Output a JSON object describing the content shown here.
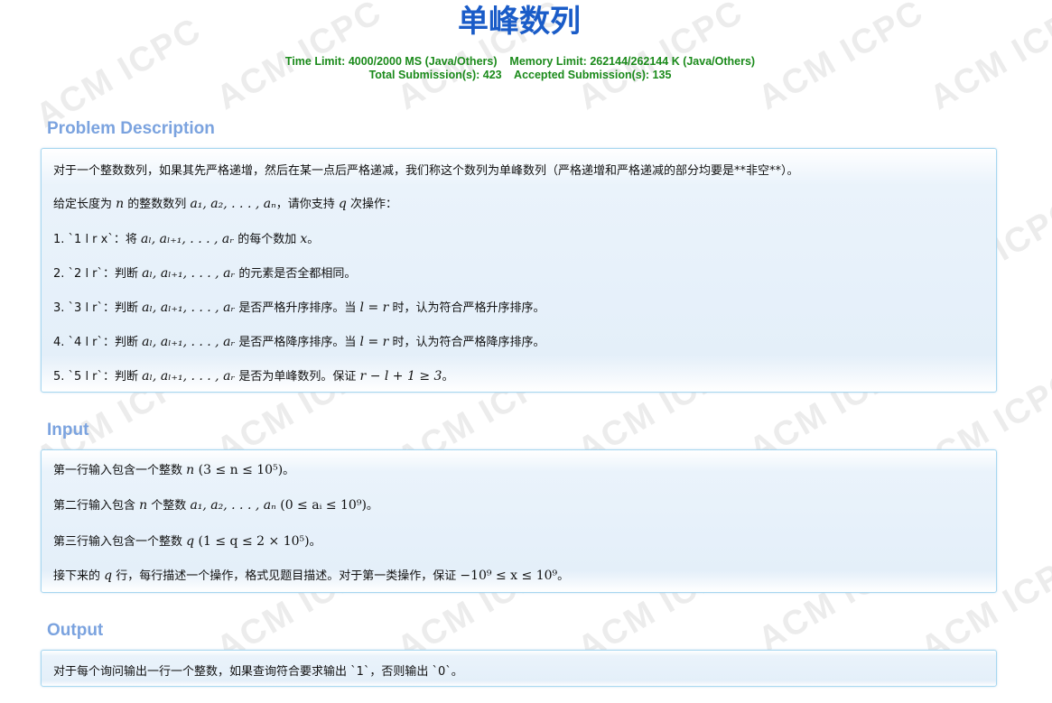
{
  "problem": {
    "title": "单峰数列",
    "time_limit": "Time Limit: 4000/2000 MS (Java/Others)",
    "memory_limit": "Memory Limit: 262144/262144 K (Java/Others)",
    "total_submissions": "Total Submission(s): 423",
    "accepted_submissions": "Accepted Submission(s): 135"
  },
  "watermark": "ACM ICPC",
  "sections": {
    "description": {
      "title": "Problem Description",
      "p1": "对于一个整数数列，如果其先严格递增，然后在某一点后严格递减，我们称这个数列为单峰数列（严格递增和严格递减的部分均要是**非空**）。",
      "p2_a": "给定长度为 ",
      "p2_n": "n",
      "p2_b": " 的整数数列 ",
      "p2_seq": "a₁, a₂, . . . , aₙ",
      "p2_c": "，请你支持 ",
      "p2_q": "q",
      "p2_d": " 次操作：",
      "op1_a": "1. `1 l r x`：将 ",
      "op1_seq": "aₗ, aₗ₊₁, . . . , aᵣ",
      "op1_b": " 的每个数加 ",
      "op1_x": "x",
      "op1_c": "。",
      "op2_a": "2. `2 l r`：判断 ",
      "op2_seq": "aₗ, aₗ₊₁, . . . , aᵣ",
      "op2_b": " 的元素是否全都相同。",
      "op3_a": "3. `3 l r`：判断 ",
      "op3_seq": "aₗ, aₗ₊₁, . . . , aᵣ",
      "op3_b": " 是否严格升序排序。当 ",
      "op3_eq": "l = r",
      "op3_c": " 时，认为符合严格升序排序。",
      "op4_a": "4. `4 l r`：判断 ",
      "op4_seq": "aₗ, aₗ₊₁, . . . , aᵣ",
      "op4_b": " 是否严格降序排序。当 ",
      "op4_eq": "l = r",
      "op4_c": " 时，认为符合严格降序排序。",
      "op5_a": "5. `5 l r`：判断 ",
      "op5_seq": "aₗ, aₗ₊₁, . . . , aᵣ",
      "op5_b": " 是否为单峰数列。保证 ",
      "op5_eq": "r − l + 1 ≥ 3",
      "op5_c": "。"
    },
    "input": {
      "title": "Input",
      "l1_a": "第一行输入包含一个整数 ",
      "l1_n": "n",
      "l1_cond": " (3 ≤ n ≤ 10⁵)",
      "l1_c": "。",
      "l2_a": "第二行输入包含 ",
      "l2_n": "n",
      "l2_b": " 个整数 ",
      "l2_seq": "a₁, a₂, . . . , aₙ",
      "l2_cond": " (0 ≤ aᵢ ≤ 10⁹)",
      "l2_c": "。",
      "l3_a": "第三行输入包含一个整数 ",
      "l3_q": "q",
      "l3_cond": " (1 ≤ q ≤ 2 × 10⁵)",
      "l3_c": "。",
      "l4_a": "接下来的 ",
      "l4_q": "q",
      "l4_b": " 行，每行描述一个操作，格式见题目描述。对于第一类操作，保证 ",
      "l4_cond": "−10⁹ ≤ x ≤ 10⁹",
      "l4_c": "。"
    },
    "output": {
      "title": "Output",
      "l1": "对于每个询问输出一行一个整数，如果查询符合要求输出 `1`，否则输出 `0`。"
    }
  }
}
